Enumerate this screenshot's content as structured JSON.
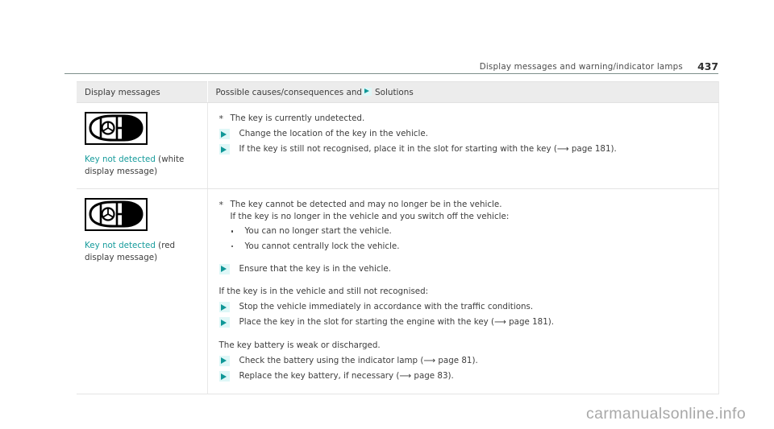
{
  "header": {
    "title": "Display messages and warning/indicator lamps",
    "page_number": "437"
  },
  "table": {
    "columns": [
      {
        "label": "Display messages"
      },
      {
        "label_before_marker": "Possible causes/consequences and",
        "marker_icon": "solutions-triangle-icon",
        "label_after_marker": "Solutions"
      }
    ],
    "rows": [
      {
        "icon": "car-key-fob-icon",
        "message_name": "Key not detected",
        "message_qualifier": "(white display message)",
        "blocks": [
          {
            "type": "cause",
            "marker": "*",
            "text": "The key is currently undetected."
          },
          {
            "type": "solution",
            "text": "Change the location of the key in the vehicle."
          },
          {
            "type": "solution",
            "text": "If the key is still not recognised, place it in the slot for starting with the key (⟶ page 181)."
          }
        ]
      },
      {
        "icon": "car-key-fob-icon",
        "message_name": "Key not detected",
        "message_qualifier": "(red display message)",
        "blocks": [
          {
            "type": "cause",
            "marker": "*",
            "text": "The key cannot be detected and may no longer be in the vehicle."
          },
          {
            "type": "cause-continued",
            "text": "If the key is no longer in the vehicle and you switch off the vehicle:"
          },
          {
            "type": "bullet",
            "text": "You can no longer start the vehicle."
          },
          {
            "type": "bullet",
            "text": "You cannot centrally lock the vehicle."
          },
          {
            "type": "solution",
            "text": "Ensure that the key is in the vehicle."
          },
          {
            "type": "paragraph",
            "text": "If the key is in the vehicle and still not recognised:"
          },
          {
            "type": "solution",
            "text": "Stop the vehicle immediately in accordance with the traffic conditions."
          },
          {
            "type": "solution",
            "text": "Place the key in the slot for starting the engine with the key (⟶ page 181)."
          },
          {
            "type": "paragraph",
            "text": "The key battery is weak or discharged."
          },
          {
            "type": "solution",
            "text": "Check the battery using the indicator lamp (⟶ page 81)."
          },
          {
            "type": "solution",
            "text": "Replace the key battery, if necessary (⟶ page 83)."
          }
        ]
      }
    ]
  },
  "watermark": "carmanualsonline.info",
  "colors": {
    "accent_teal": "#179c9c",
    "marker_teal": "#0f9797",
    "marker_highlight": "#dff7f7",
    "header_rule": "#7e8f8c",
    "table_header_bg": "#ececec",
    "watermark_gray": "#a8a8a8"
  }
}
